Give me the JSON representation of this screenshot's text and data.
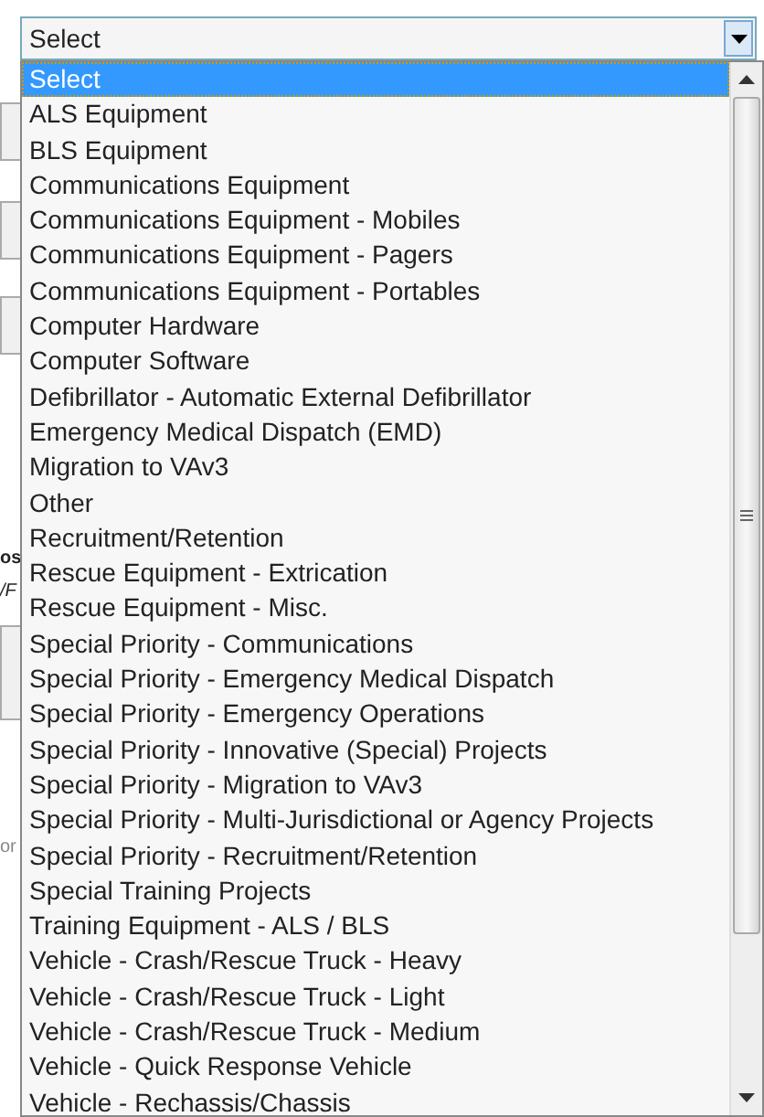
{
  "select": {
    "value": "Select",
    "expanded": true
  },
  "background_fragments": [
    {
      "text": "os",
      "kind": "bold"
    },
    {
      "text": "/F",
      "kind": "italic"
    },
    {
      "text": "or",
      "kind": "muted"
    }
  ],
  "options": [
    {
      "label": "Select",
      "selected": true
    },
    {
      "label": "ALS Equipment",
      "selected": false
    },
    {
      "label": "BLS Equipment",
      "selected": false
    },
    {
      "label": "Communications Equipment",
      "selected": false
    },
    {
      "label": "Communications Equipment - Mobiles",
      "selected": false
    },
    {
      "label": "Communications Equipment - Pagers",
      "selected": false
    },
    {
      "label": "Communications Equipment - Portables",
      "selected": false
    },
    {
      "label": "Computer Hardware",
      "selected": false
    },
    {
      "label": "Computer Software",
      "selected": false
    },
    {
      "label": "Defibrillator - Automatic External Defibrillator",
      "selected": false
    },
    {
      "label": "Emergency Medical Dispatch (EMD)",
      "selected": false
    },
    {
      "label": "Migration to VAv3",
      "selected": false
    },
    {
      "label": "Other",
      "selected": false
    },
    {
      "label": "Recruitment/Retention",
      "selected": false
    },
    {
      "label": "Rescue Equipment - Extrication",
      "selected": false
    },
    {
      "label": "Rescue Equipment - Misc.",
      "selected": false
    },
    {
      "label": "Special Priority - Communications",
      "selected": false
    },
    {
      "label": "Special Priority - Emergency Medical Dispatch",
      "selected": false
    },
    {
      "label": "Special Priority - Emergency Operations",
      "selected": false
    },
    {
      "label": "Special Priority - Innovative (Special) Projects",
      "selected": false
    },
    {
      "label": "Special Priority - Migration to VAv3",
      "selected": false
    },
    {
      "label": "Special Priority - Multi-Jurisdictional or Agency Projects",
      "selected": false
    },
    {
      "label": "Special Priority - Recruitment/Retention",
      "selected": false
    },
    {
      "label": "Special Training Projects",
      "selected": false
    },
    {
      "label": "Training Equipment - ALS / BLS",
      "selected": false
    },
    {
      "label": "Vehicle - Crash/Rescue Truck - Heavy",
      "selected": false
    },
    {
      "label": "Vehicle - Crash/Rescue Truck - Light",
      "selected": false
    },
    {
      "label": "Vehicle - Crash/Rescue Truck - Medium",
      "selected": false
    },
    {
      "label": "Vehicle - Quick Response Vehicle",
      "selected": false
    },
    {
      "label": "Vehicle - Rechassis/Chassis",
      "selected": false
    }
  ]
}
